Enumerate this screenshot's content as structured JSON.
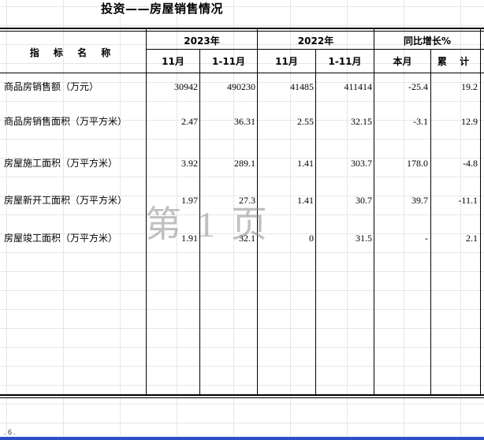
{
  "title": "投资——房屋销售情况",
  "header": {
    "indicator_label": "指 标 名 称",
    "year_2023": "2023年",
    "year_2022": "2022年",
    "yoy_growth": "同比增长%",
    "sub": [
      "11月",
      "1-11月",
      "11月",
      "1-11月",
      "本月",
      "累 计"
    ]
  },
  "rows": [
    {
      "label": "商品房销售额（万元）",
      "values": [
        "30942",
        "490230",
        "41485",
        "411414",
        "-25.4",
        "19.2"
      ]
    },
    {
      "label": "商品房销售面积（万平方米）",
      "values": [
        "2.47",
        "36.31",
        "2.55",
        "32.15",
        "-3.1",
        "12.9"
      ]
    },
    {
      "label": "房屋施工面积（万平方米）",
      "values": [
        "3.92",
        "289.1",
        "1.41",
        "303.7",
        "178.0",
        "-4.8"
      ]
    },
    {
      "label": "房屋新开工面积（万平方米）",
      "values": [
        "1.97",
        "27.3",
        "1.41",
        "30.7",
        "39.7",
        "-11.1"
      ]
    },
    {
      "label": "房屋竣工面积（万平方米）",
      "values": [
        "1.91",
        "32.1",
        "0",
        "31.5",
        "-",
        "2.1"
      ]
    }
  ],
  "watermark": {
    "left": "第",
    "mid": "1",
    "right": "页"
  },
  "footer": ". 6 ."
}
